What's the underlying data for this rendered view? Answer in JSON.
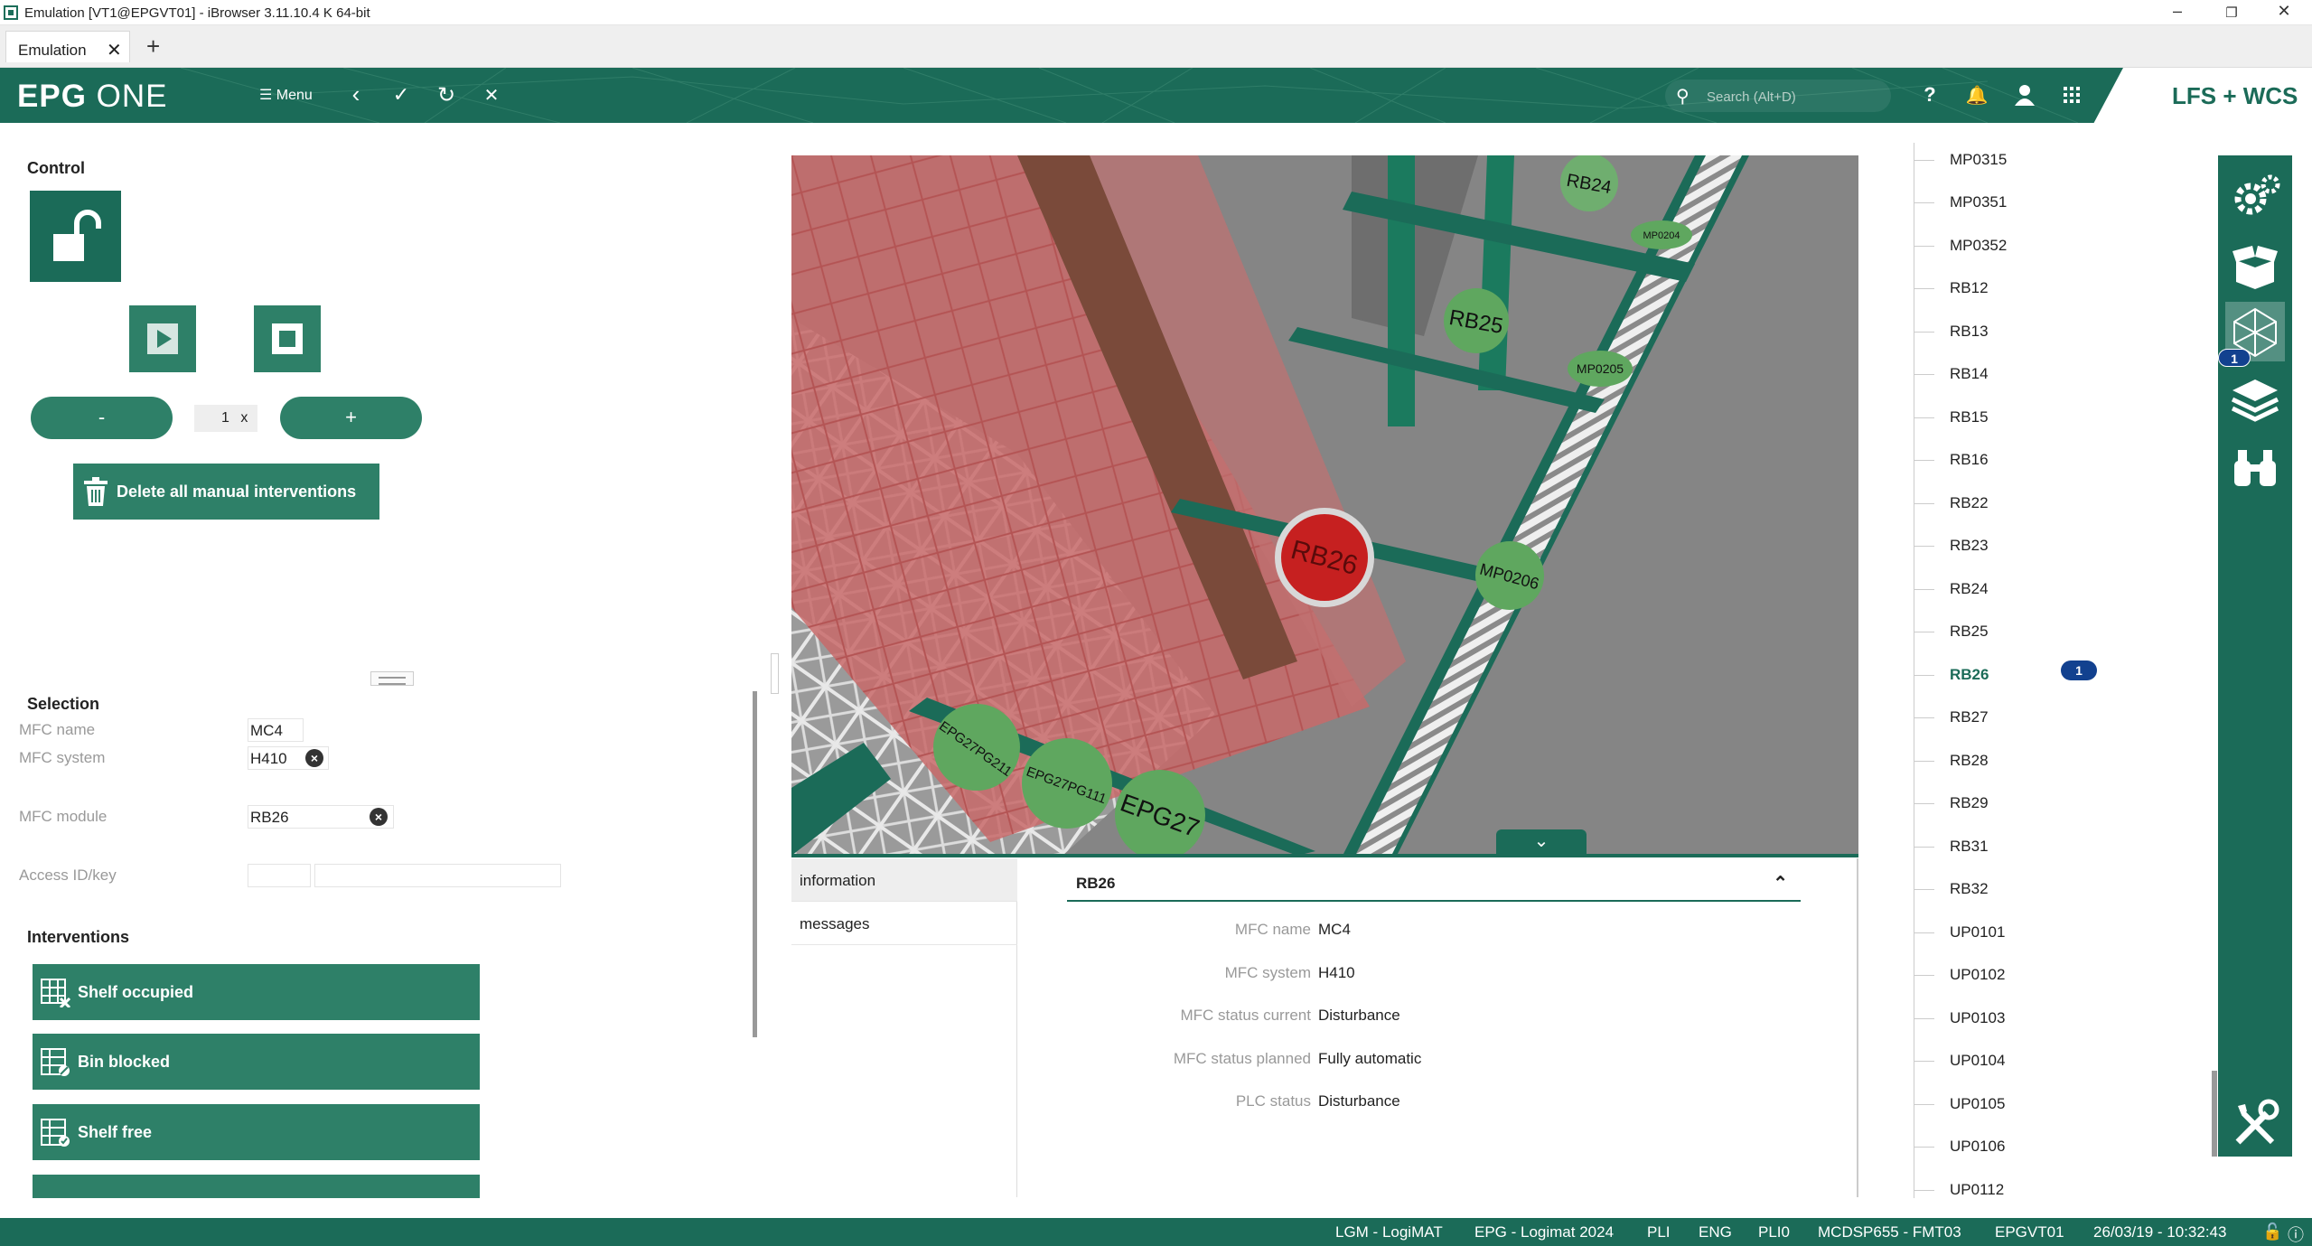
{
  "window": {
    "title": "Emulation [VT1@EPGVT01] - iBrowser 3.11.10.4 K 64-bit"
  },
  "tabs": [
    {
      "label": "Emulation"
    }
  ],
  "appbar": {
    "logo_bold": "EPG",
    "logo_light": "ONE",
    "menu_label": "Menu",
    "search_placeholder": "Search (Alt+D)",
    "brand": "LFS + WCS"
  },
  "control": {
    "title": "Control",
    "minus_label": "-",
    "plus_label": "+",
    "speed_value": "1",
    "speed_unit": "x",
    "delete_label": "Delete all manual interventions"
  },
  "selection": {
    "title": "Selection",
    "mfc_name_label": "MFC name",
    "mfc_name_value": "MC4",
    "mfc_system_label": "MFC system",
    "mfc_system_value": "H410",
    "mfc_module_label": "MFC module",
    "mfc_module_value": "RB26",
    "access_label": "Access ID/key"
  },
  "interventions": {
    "title": "Interventions",
    "items": [
      "Shelf occupied",
      "Bin blocked",
      "Shelf free"
    ]
  },
  "scene_labels": {
    "rb24": "RB24",
    "rb25": "RB25",
    "rb26": "RB26",
    "mp0204": "MP0204",
    "mp0205": "MP0205",
    "mp0206": "MP0206",
    "epg27pg211": "EPG27PG211",
    "epg27pg111": "EPG27PG111",
    "epg27": "EPG27"
  },
  "info_tabs": [
    "information",
    "messages"
  ],
  "detail": {
    "header": "RB26",
    "rows": [
      {
        "label": "MFC name",
        "value": "MC4"
      },
      {
        "label": "MFC system",
        "value": "H410"
      },
      {
        "label": "MFC status current",
        "value": "Disturbance"
      },
      {
        "label": "MFC status planned",
        "value": "Fully automatic"
      },
      {
        "label": "PLC status",
        "value": "Disturbance"
      }
    ]
  },
  "module_list": {
    "items": [
      "MP0315",
      "MP0351",
      "MP0352",
      "RB12",
      "RB13",
      "RB14",
      "RB15",
      "RB16",
      "RB22",
      "RB23",
      "RB24",
      "RB25",
      "RB26",
      "RB27",
      "RB28",
      "RB29",
      "RB31",
      "RB32",
      "UP0101",
      "UP0102",
      "UP0103",
      "UP0104",
      "UP0105",
      "UP0106",
      "UP0112"
    ],
    "selected": "RB26",
    "selected_badge": "1"
  },
  "rail": {
    "layers_badge": "1"
  },
  "statusbar": {
    "items": [
      "LGM - LogiMAT",
      "EPG - Logimat 2024",
      "PLI",
      "ENG",
      "PLI0",
      "MCDSP655 - FMT03",
      "EPGVT01",
      "26/03/19 - 10:32:43"
    ]
  },
  "colors": {
    "primary": "#1b6b58",
    "button": "#2e8068",
    "badge": "#12418f",
    "alarm": "#c62020"
  }
}
